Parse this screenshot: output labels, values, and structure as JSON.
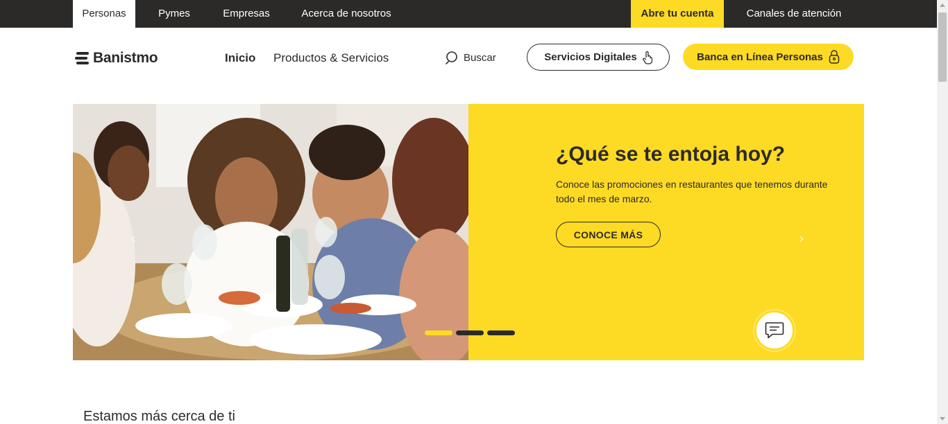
{
  "topbar": {
    "tabs": [
      {
        "label": "Personas",
        "active": true
      },
      {
        "label": "Pymes"
      },
      {
        "label": "Empresas"
      },
      {
        "label": "Acerca de nosotros"
      }
    ],
    "open_account": "Abre tu cuenta",
    "contact_channels": "Canales de atención"
  },
  "header": {
    "logo_text": "Banistmo",
    "nav": [
      {
        "label": "Inicio",
        "active": true
      },
      {
        "label": "Productos & Servicios"
      }
    ],
    "search_label": "Buscar",
    "search_icon": "search-icon",
    "digital_services": "Servicios Digitales",
    "digital_services_icon": "touch-hand-icon",
    "online_banking": "Banca en Línea Personas",
    "online_banking_icon": "padlock-icon"
  },
  "hero": {
    "title": "¿Qué se te entoja hoy?",
    "description": "Conoce las promociones en restaurantes que tenemos durante todo el mes de marzo.",
    "cta": "CONOCE MÁS",
    "prev_arrow": "‹",
    "next_arrow": "›",
    "slides_total": 3,
    "active_slide": 1,
    "chat_icon": "chat-icon"
  },
  "section": {
    "title": "Estamos más cerca de ti"
  },
  "colors": {
    "brand_yellow": "#fdda24",
    "dark": "#2c2a29",
    "white": "#ffffff"
  }
}
